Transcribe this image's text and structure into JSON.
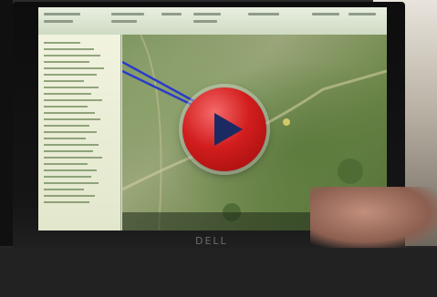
{
  "video": {
    "play_button": {
      "icon": "play-icon",
      "color": "#c81e1e"
    },
    "screen_logo_text": "DELL"
  },
  "colors": {
    "background": "#1b1b1b",
    "map_green": "#7f9661",
    "route_blue": "#2a3cc8",
    "play_red": "#c81e1e"
  }
}
